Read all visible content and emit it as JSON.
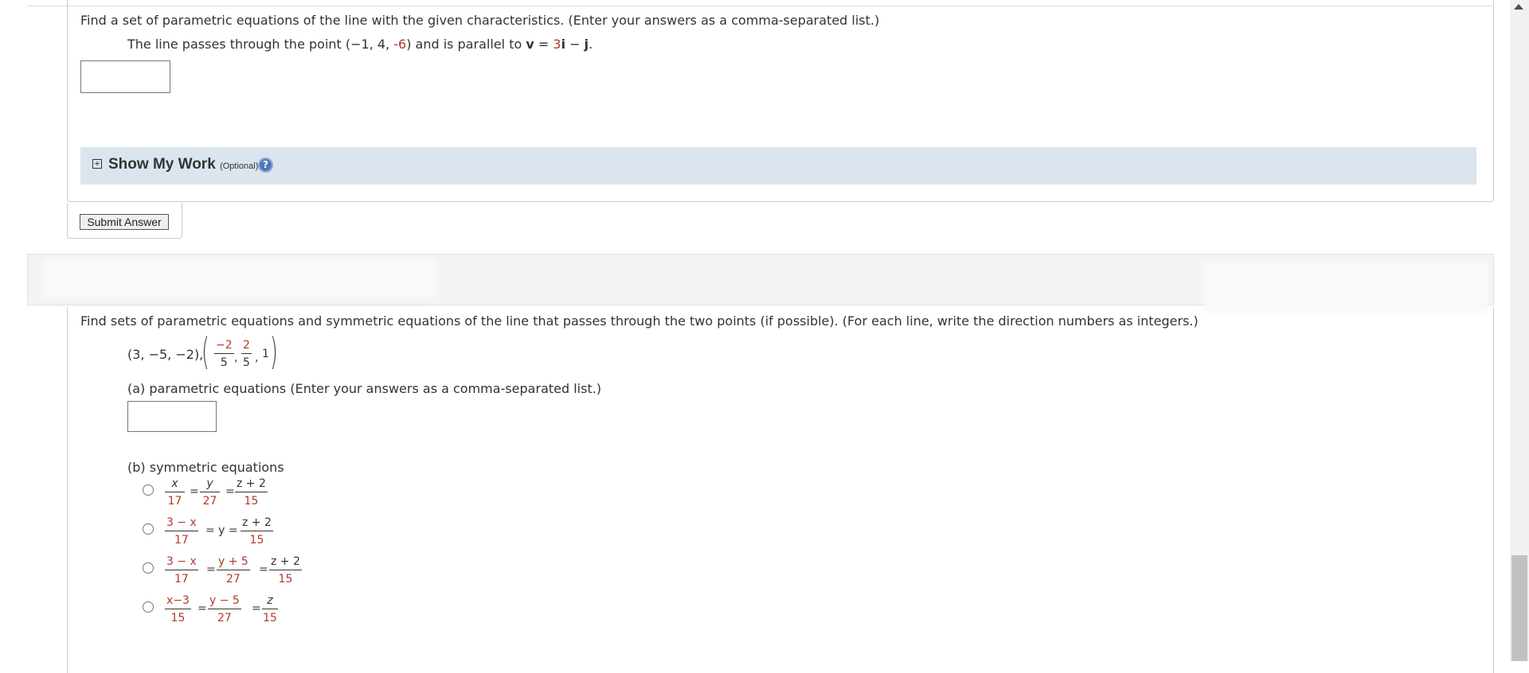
{
  "q1": {
    "instruction": "Find a set of parametric equations of the line with the given characteristics. (Enter your answers as a comma-separated list.)",
    "line_prefix": "The line passes through the point (",
    "point": [
      "−1",
      "4",
      "-6"
    ],
    "line_mid": ") and is parallel to ",
    "vec_name": "v",
    "vec_eq": " = ",
    "vec_i_coef": "3",
    "vec_i": "i",
    "vec_minus": " − ",
    "vec_j": "j",
    "line_suffix": ".",
    "answer_value": "",
    "show_my_work": {
      "label": "Show My Work",
      "optional": "(Optional)",
      "help": "?"
    },
    "submit_label": "Submit Answer"
  },
  "q2": {
    "instruction": "Find sets of parametric equations and symmetric equations of the line that passes through the two points (if possible). (For each line, write the direction numbers as integers.)",
    "point1": "(3, −5, −2),",
    "point2": {
      "x_num": "−2",
      "x_den": "5",
      "y_num": "2",
      "y_den": "5",
      "z": "1"
    },
    "part_a": "(a) parametric equations (Enter your answers as a comma-separated list.)",
    "answer_value": "",
    "part_b": "(b) symmetric equations",
    "options": [
      {
        "t1_num": "x",
        "t1_den": "17",
        "t2_num": "y",
        "t2_den": "27",
        "t3_num": "z + 2",
        "t3_den": "15"
      },
      {
        "t1_num": "3 − x",
        "t1_den": "17",
        "t2_plain": "= y =",
        "t3_num": "z + 2",
        "t3_den": "15"
      },
      {
        "t1_num": "3 − x",
        "t1_den": "17",
        "t2_num": "y + 5",
        "t2_den": "27",
        "t3_num": "z + 2",
        "t3_den": "15"
      },
      {
        "t1_num": "x−3",
        "t1_den": "15",
        "t2_num": "y − 5",
        "t2_den": "27",
        "t3_num": "z",
        "t3_den": "15"
      }
    ],
    "eq_sign": "="
  }
}
